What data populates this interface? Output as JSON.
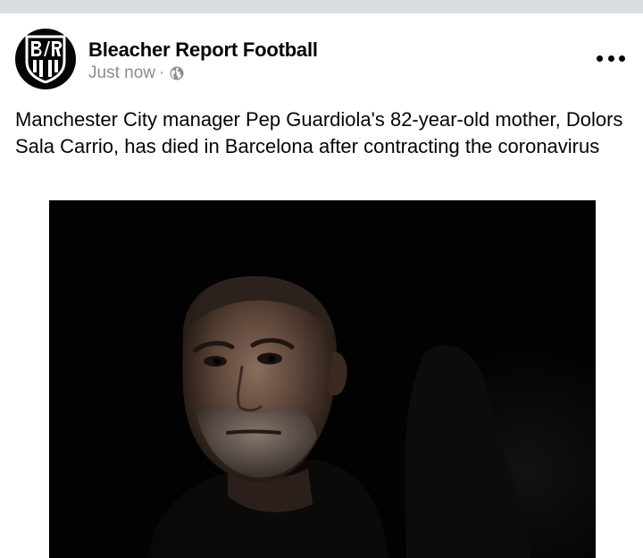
{
  "post": {
    "author": "Bleacher Report Football",
    "timestamp": "Just now",
    "separator": "·",
    "privacy_icon": "globe-icon",
    "more_icon": "more-options-icon",
    "text": "Manchester City manager Pep Guardiola's 82-year-old mother, Dolors Sala Carrio, has died in Barcelona after contracting the coronavirus",
    "avatar": {
      "logo_text": "B/R",
      "background": "#050505",
      "foreground": "#ffffff"
    },
    "image": {
      "subject": "photo-of-man"
    }
  },
  "colors": {
    "divider": "#dadde1",
    "text_primary": "#050505",
    "text_secondary": "#8a8d91"
  }
}
